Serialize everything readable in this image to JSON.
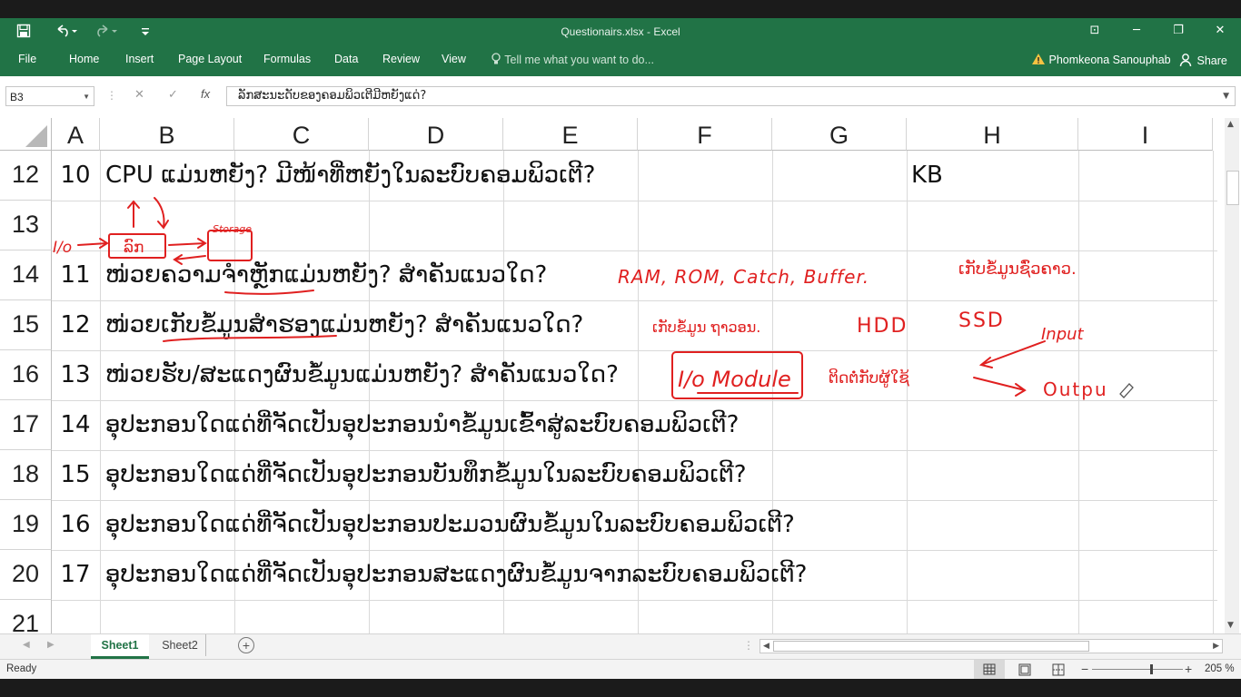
{
  "window": {
    "title": "Questionairs.xlsx - Excel",
    "save_icon": "save-icon",
    "undo_icon": "undo-icon",
    "redo_icon": "redo-icon",
    "customize_icon": "customize-qat-icon",
    "minimize": "─",
    "restore": "❐",
    "close": "✕",
    "ribbon_display": "⊡"
  },
  "ribbon": {
    "tabs": [
      "File",
      "Home",
      "Insert",
      "Page Layout",
      "Formulas",
      "Data",
      "Review",
      "View"
    ],
    "tell_me": "Tell me what you want to do...",
    "user": "Phomkeona Sanouphab",
    "share": "Share",
    "accent": "#217346"
  },
  "formula_bar": {
    "name_box": "B3",
    "cancel": "✕",
    "enter": "✓",
    "fx": "fx",
    "content": "ລັກສະນະດັບຂອງຄອມພິວເຕີມີຫຍັງແດ່?"
  },
  "columns": [
    "A",
    "B",
    "C",
    "D",
    "E",
    "F",
    "G",
    "H",
    "I"
  ],
  "rows": [
    {
      "row": "12",
      "a": "10",
      "b": "CPU  ແມ່ນຫຍັງ?  ມີໜ້າທີ່ຫຍັງໃນລະບົບຄອມພິວເຕີ?",
      "h": "KB"
    },
    {
      "row": "13",
      "a": "",
      "b": "",
      "h": ""
    },
    {
      "row": "14",
      "a": "11",
      "b": "ໜ່ວຍຄວາມຈຳຫຼັກແມ່ນຫຍັງ?   ສຳຄັນແນວໃດ?",
      "h": ""
    },
    {
      "row": "15",
      "a": "12",
      "b": "ໜ່ວຍເກັບຂໍ້ມູນສຳຮອງແມ່ນຫຍັງ?  ສຳຄັນແນວໃດ?",
      "h": ""
    },
    {
      "row": "16",
      "a": "13",
      "b": "ໜ່ວຍຮັບ/ສະແດງຜົນຂໍ້ມູນແມ່ນຫຍັງ?  ສຳຄັນແນວໃດ?",
      "h": ""
    },
    {
      "row": "17",
      "a": "14",
      "b": "ອຸປະກອນໃດແດ່ທີ່ຈັດເປັນອຸປະກອນນຳຂໍ້ມູນເຂົ້າສູ່ລະບົບຄອມພິວເຕີ?",
      "h": ""
    },
    {
      "row": "18",
      "a": "15",
      "b": "ອຸປະກອນໃດແດ່ທີ່ຈັດເປັນອຸປະກອນບັນທຶກຂໍ້ມູນໃນລະບົບຄອມພິວເຕີ?",
      "h": ""
    },
    {
      "row": "19",
      "a": "16",
      "b": "ອຸປະກອນໃດແດ່ທີ່ຈັດເປັນອຸປະກອນປະມວນຜົນຂໍ້ມູນໃນລະບົບຄອມພິວເຕີ?",
      "h": ""
    },
    {
      "row": "20",
      "a": "17",
      "b": "ອຸປະກອນໃດແດ່ທີ່ຈັດເປັນອຸປະກອນສະແດງຜົນຂໍ້ມູນຈາກລະບົບຄອມພິວເຕີ?",
      "h": ""
    },
    {
      "row": "21",
      "a": "",
      "b": "",
      "h": ""
    }
  ],
  "annotations": {
    "color": "#e02020",
    "row13_io": "I/o",
    "row13_box": "ລົກ",
    "row13_storage": "Storage",
    "row14_types": "RAM, ROM, Catch, Buffer.",
    "row14_note": "ເກັບຂໍ້ມູນຊົ່ວຄາວ.",
    "row15_note": "ເກັບຂໍ້ມູນ ຖາວອນ.",
    "row15_hdd": "HDD",
    "row15_ssd": "SSD",
    "row16_input": "Input",
    "row16_module": "I/o Module",
    "row16_note": "ຕິດຕໍ່ກັບຜູ້ໃຊ້",
    "row16_output": "Outpu"
  },
  "sheets": {
    "tabs": [
      "Sheet1",
      "Sheet2"
    ],
    "active": "Sheet1",
    "add": "+"
  },
  "status": {
    "ready": "Ready",
    "zoom": "205 %"
  }
}
